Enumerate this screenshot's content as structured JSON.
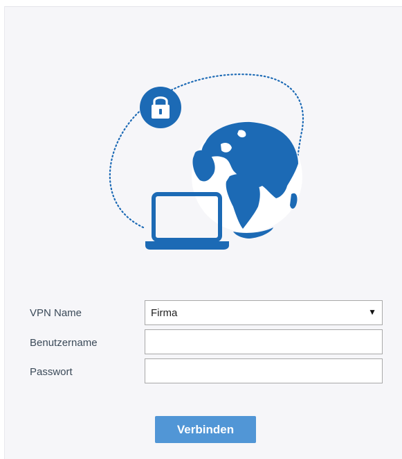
{
  "illustration": {
    "lock_icon": "lock-icon",
    "globe_icon": "globe-icon",
    "laptop_icon": "laptop-icon",
    "accent_color": "#1c6ab5"
  },
  "form": {
    "vpn_name_label": "VPN Name",
    "vpn_name_value": "Firma",
    "username_label": "Benutzername",
    "username_value": "",
    "password_label": "Passwort",
    "password_value": ""
  },
  "actions": {
    "connect_label": "Verbinden",
    "button_color": "#5196d6"
  }
}
